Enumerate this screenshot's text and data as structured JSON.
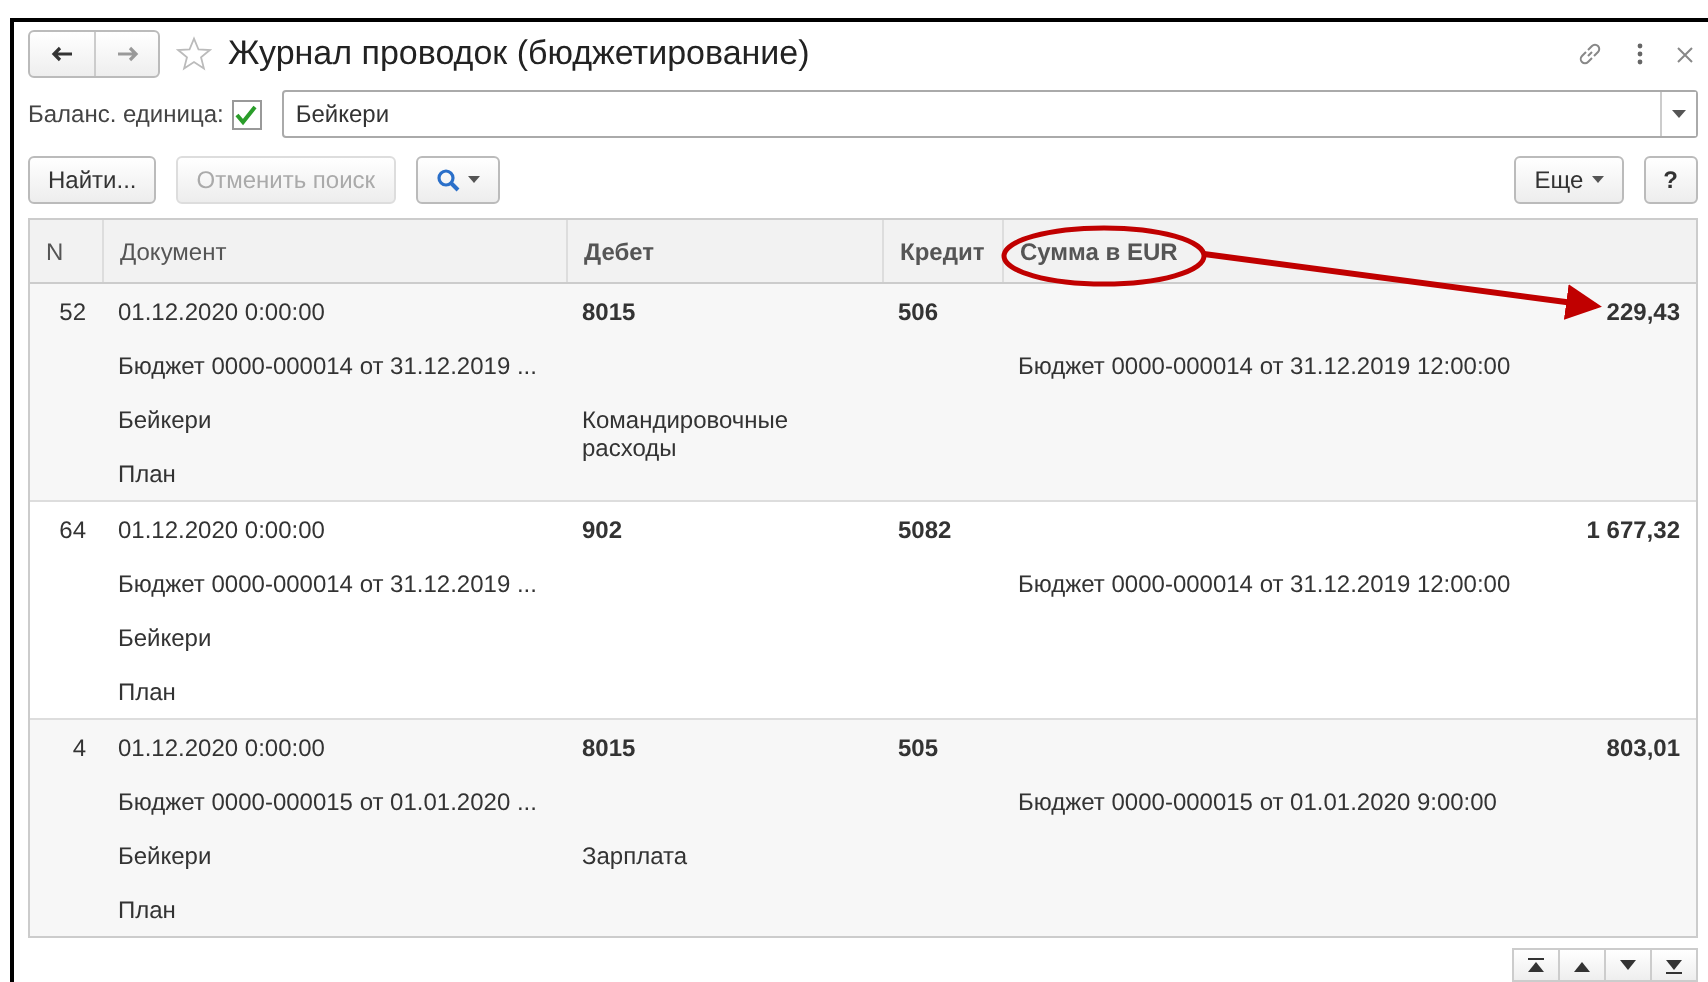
{
  "window": {
    "title": "Журнал проводок (бюджетирование)"
  },
  "filter": {
    "label": "Баланс. единица:",
    "checked": true,
    "value": "Бейкери"
  },
  "toolbar": {
    "buttons": [
      {
        "label": "Найти...",
        "disabled": false
      },
      {
        "label": "Отменить поиск",
        "disabled": true
      }
    ],
    "more": "Еще",
    "help": "?"
  },
  "table": {
    "columns": [
      "N",
      "Документ",
      "Дебет",
      "Кредит",
      "Сумма в EUR"
    ],
    "rows": [
      {
        "n": "52",
        "date": "01.12.2020 0:00:00",
        "debit": "8015",
        "credit": "506",
        "amount": "229,43",
        "document": "Бюджет 0000-000014 от 31.12.2019 ...",
        "register_doc": "Бюджет 0000-000014 от 31.12.2019 12:00:00",
        "company": "Бейкери",
        "debit_item": "Командировочные расходы",
        "scenario": "План"
      },
      {
        "n": "64",
        "date": "01.12.2020 0:00:00",
        "debit": "902",
        "credit": "5082",
        "amount": "1 677,32",
        "document": "Бюджет 0000-000014 от 31.12.2019 ...",
        "register_doc": "Бюджет 0000-000014 от 31.12.2019 12:00:00",
        "company": "Бейкери",
        "scenario": "План"
      },
      {
        "n": "4",
        "date": "01.12.2020 0:00:00",
        "debit": "8015",
        "credit": "505",
        "amount": "803,01",
        "document": "Бюджет 0000-000015 от 01.01.2020 ...",
        "register_doc": "Бюджет 0000-000015 от 01.01.2020 9:00:00",
        "company": "Бейкери",
        "debit_item": "Зарплата",
        "scenario": "План"
      }
    ]
  }
}
